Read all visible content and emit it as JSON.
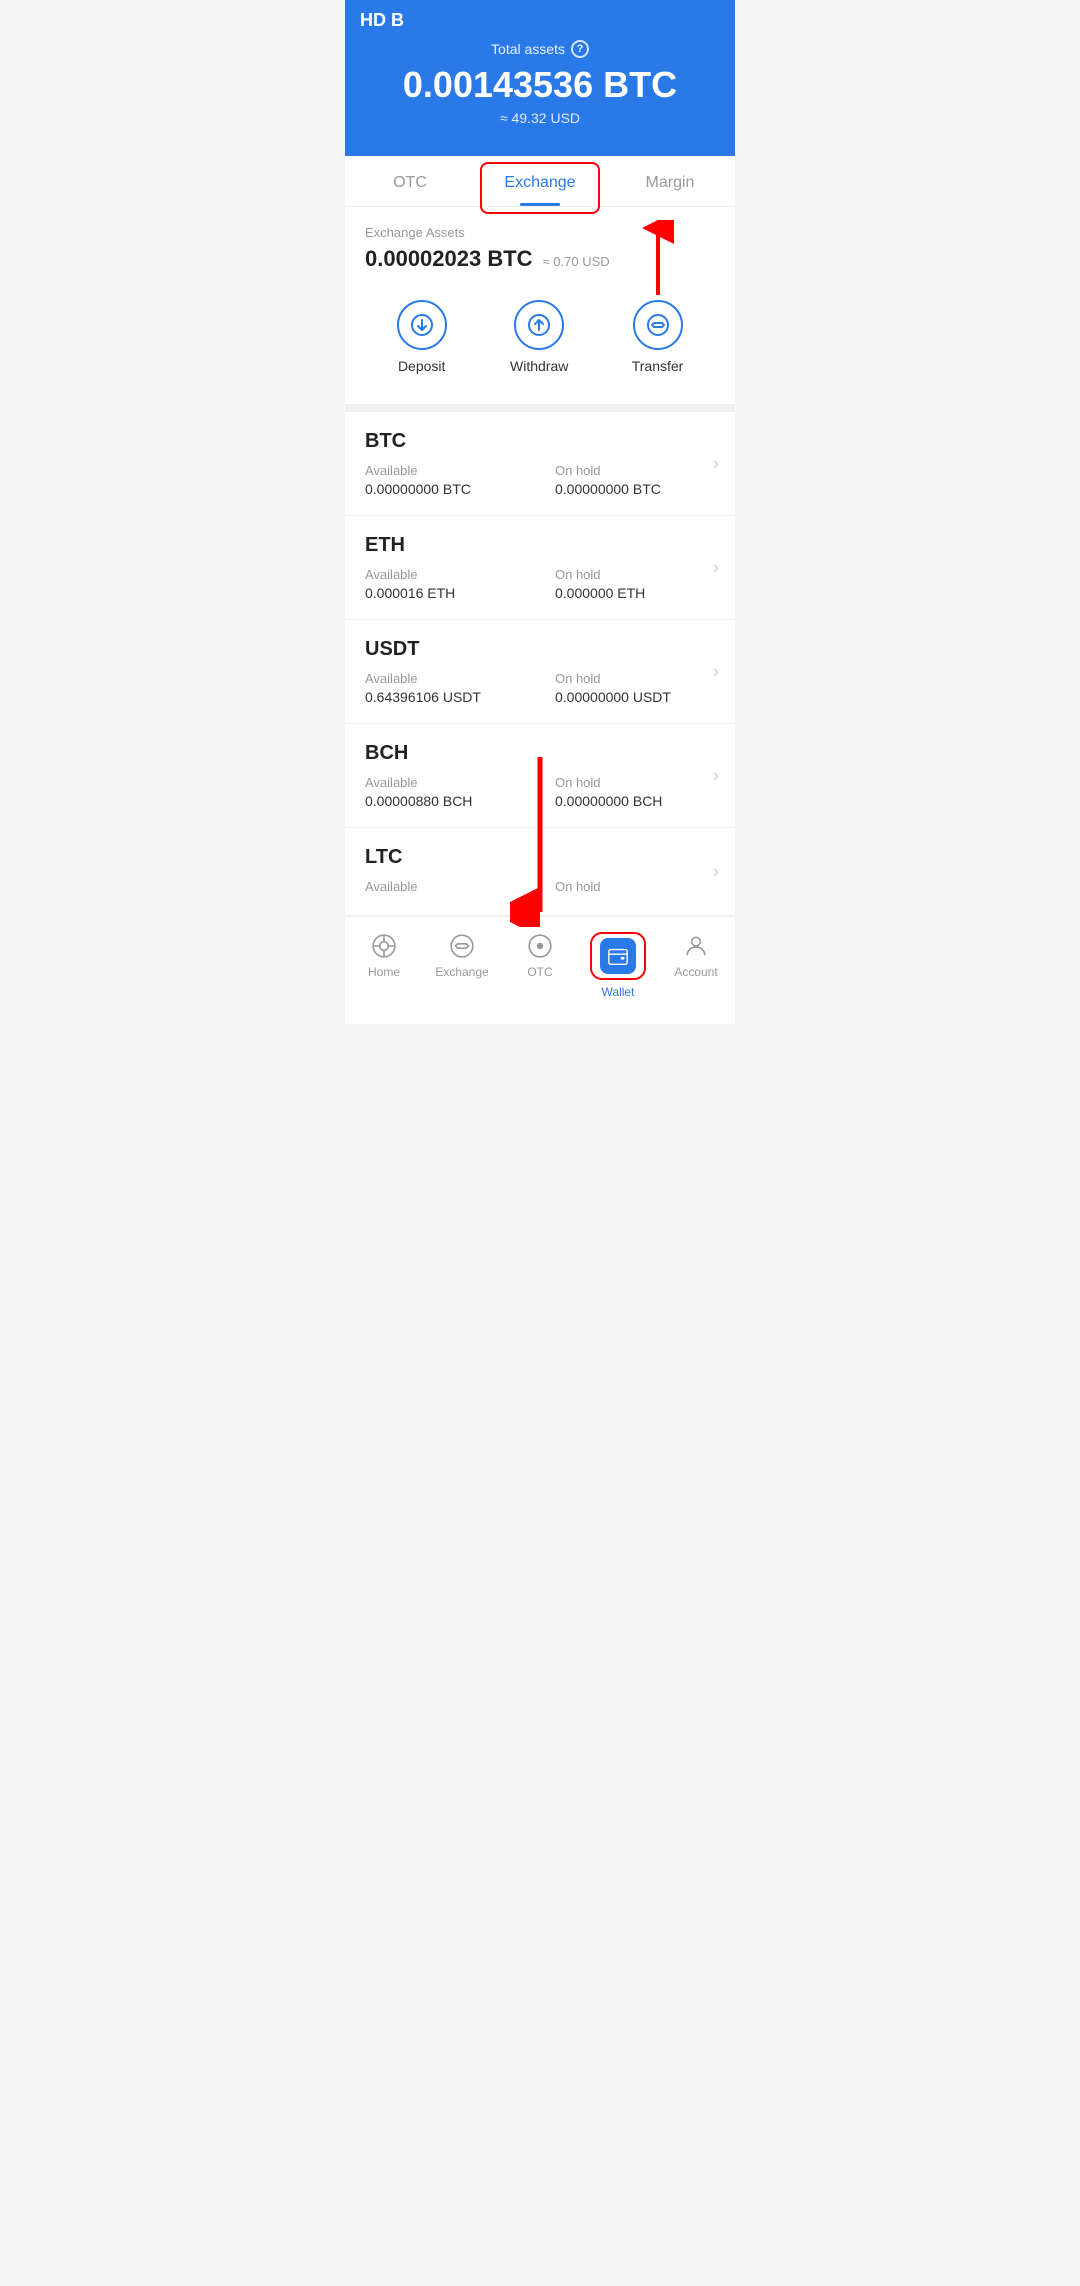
{
  "header": {
    "total_assets_label": "Total assets",
    "btc_amount": "0.00143536 BTC",
    "usd_amount": "≈ 49.32 USD"
  },
  "tabs": {
    "otc": "OTC",
    "exchange": "Exchange",
    "margin": "Margin"
  },
  "exchange": {
    "assets_label": "Exchange Assets",
    "btc_amount": "0.00002023 BTC",
    "usd_amount": "≈ 0.70 USD"
  },
  "actions": {
    "deposit": "Deposit",
    "withdraw": "Withdraw",
    "transfer": "Transfer"
  },
  "assets": [
    {
      "name": "BTC",
      "available_label": "Available",
      "available_value": "0.00000000 BTC",
      "onhold_label": "On hold",
      "onhold_value": "0.00000000 BTC"
    },
    {
      "name": "ETH",
      "available_label": "Available",
      "available_value": "0.000016 ETH",
      "onhold_label": "On hold",
      "onhold_value": "0.000000 ETH"
    },
    {
      "name": "USDT",
      "available_label": "Available",
      "available_value": "0.64396106 USDT",
      "onhold_label": "On hold",
      "onhold_value": "0.00000000 USDT"
    },
    {
      "name": "BCH",
      "available_label": "Available",
      "available_value": "0.00000880 BCH",
      "onhold_label": "On hold",
      "onhold_value": "0.00000000 BCH"
    },
    {
      "name": "LTC",
      "available_label": "Available",
      "available_value": "",
      "onhold_label": "On hold",
      "onhold_value": ""
    }
  ],
  "bottom_nav": {
    "home": "Home",
    "exchange": "Exchange",
    "otc": "OTC",
    "wallet": "Wallet",
    "account": "Account"
  }
}
